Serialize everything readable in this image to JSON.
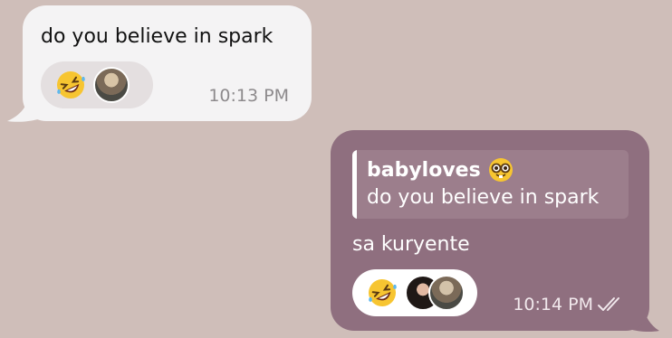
{
  "incoming": {
    "text": "do you believe in spark",
    "reaction_emoji": "rolling-on-floor-laughing-emoji",
    "time": "10:13 PM"
  },
  "outgoing": {
    "reply_to": {
      "name": "babyloves",
      "name_emoji": "nerd-face-emoji",
      "text": "do you believe in spark"
    },
    "text": "sa kuryente",
    "reaction_emoji": "rolling-on-floor-laughing-emoji",
    "time": "10:14 PM",
    "status": "read-double-check"
  },
  "colors": {
    "background": "#cfbeb9",
    "incoming_bubble": "#f4f3f4",
    "outgoing_bubble": "#8f6f7f",
    "reply_quote": "#9c7e8c"
  }
}
